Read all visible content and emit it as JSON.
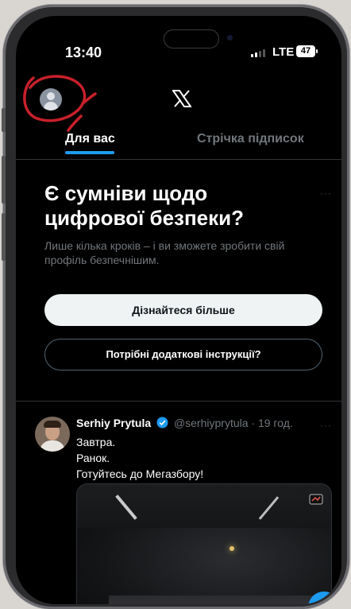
{
  "status_bar": {
    "time": "13:40",
    "network": "LTE",
    "battery": "47"
  },
  "header": {
    "logo": "x-logo-icon"
  },
  "tabs": [
    {
      "label": "Для вас",
      "active": true
    },
    {
      "label": "Стрічка підписок",
      "active": false
    }
  ],
  "promo": {
    "title": "Є сумніви щодо цифрової безпеки?",
    "subtitle": "Лише кілька кроків – і ви зможете зробити свій профіль безпечнішим.",
    "primary_button": "Дізнайтеся більше",
    "secondary_button": "Потрібні додаткові інструкції?",
    "more": "···"
  },
  "tweet": {
    "author_name": "Serhiy Prytula",
    "handle": "@serhiyprytula",
    "separator": "·",
    "time": "19 год.",
    "more": "···",
    "lines": [
      "Завтра.",
      "Ранок.",
      "Готуйтесь до Мегазбору!"
    ]
  },
  "colors": {
    "accent": "#1d9bf0",
    "background": "#000000",
    "annotation": "#c8202a"
  }
}
